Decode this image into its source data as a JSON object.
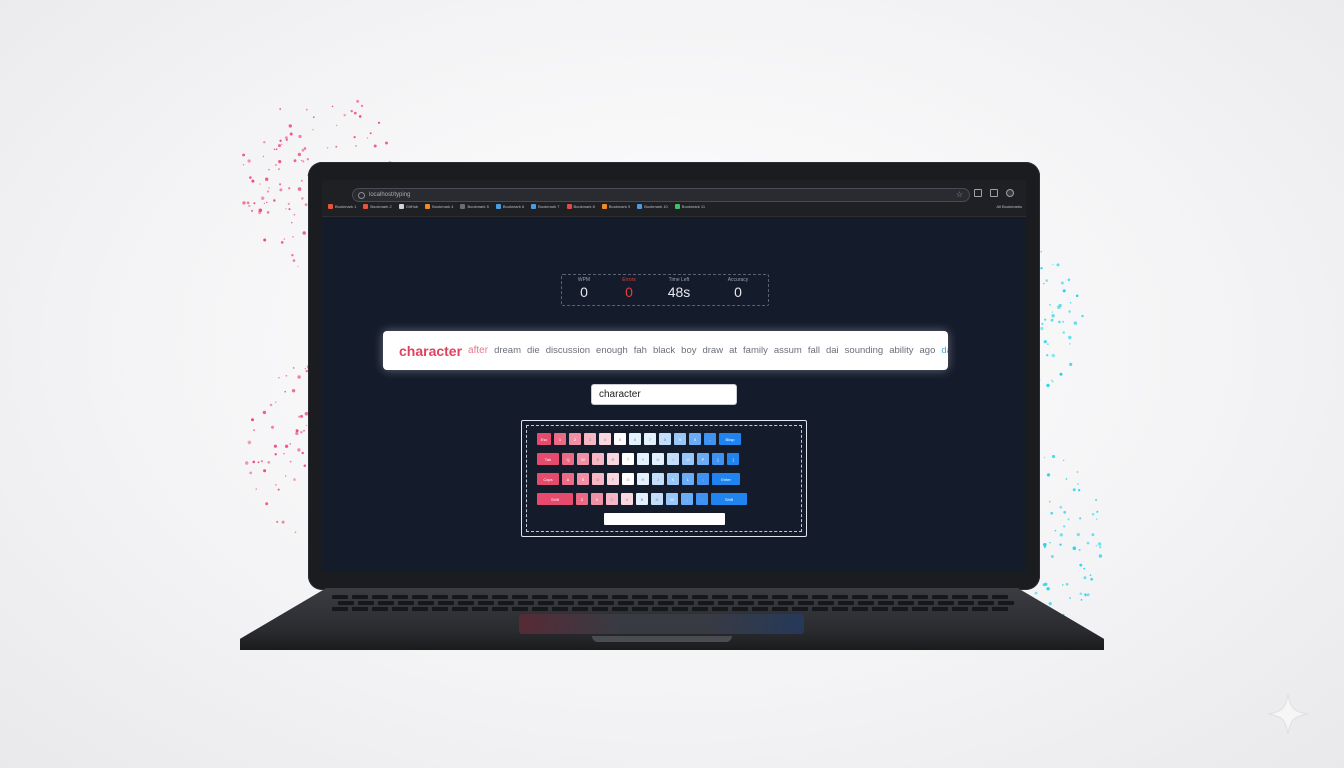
{
  "browser": {
    "address": "localhost/typing",
    "bookmarks": [
      {
        "label": "Bookmark 1",
        "color": "#e8543a"
      },
      {
        "label": "Bookmark 2",
        "color": "#e8543a"
      },
      {
        "label": "GitHub",
        "color": "#d0d3da"
      },
      {
        "label": "Bookmark 4",
        "color": "#f08a24"
      },
      {
        "label": "Bookmark 5",
        "color": "#6a6d75"
      },
      {
        "label": "Bookmark 6",
        "color": "#4a9be0"
      },
      {
        "label": "Bookmark 7",
        "color": "#4a9be0"
      },
      {
        "label": "Bookmark 8",
        "color": "#e24a4a"
      },
      {
        "label": "Bookmark 9",
        "color": "#f08a24"
      },
      {
        "label": "Bookmark 10",
        "color": "#4a9be0"
      },
      {
        "label": "Bookmark 11",
        "color": "#3fbf6a"
      }
    ],
    "all_bookmarks": "All Bookmarks"
  },
  "stats": {
    "wpm": {
      "label": "WPM",
      "value": "0"
    },
    "errors": {
      "label": "Errors",
      "value": "0"
    },
    "time": {
      "label": "Time Left",
      "value": "48s"
    },
    "accuracy": {
      "label": "Accuracy",
      "value": "0"
    }
  },
  "words": [
    "character",
    "after",
    "dream",
    "die",
    "discussion",
    "enough",
    "fah",
    "black",
    "boy",
    "draw",
    "at",
    "family",
    "assum",
    "fall",
    "dai",
    "sounding",
    "ability",
    "ago",
    "day"
  ],
  "input": {
    "value": "character"
  },
  "keyboard": {
    "rows": [
      [
        "Esc",
        "1",
        "2",
        "3",
        "4",
        "5",
        "6",
        "7",
        "8",
        "9",
        "0",
        "-",
        "Bksp"
      ],
      [
        "Tab",
        "Q",
        "W",
        "E",
        "R",
        "T",
        "Y",
        "U",
        "I",
        "O",
        "P",
        "[",
        "]"
      ],
      [
        "Caps",
        "A",
        "S",
        "D",
        "F",
        "G",
        "H",
        "J",
        "K",
        "L",
        ";",
        "Enter"
      ],
      [
        "Shift",
        "Z",
        "X",
        "C",
        "V",
        "B",
        "N",
        "M",
        ",",
        ".",
        "Shift"
      ]
    ]
  },
  "colors": {
    "accent_pink": "#e0415d",
    "accent_blue": "#1f84f0",
    "error_red": "#e53c3c",
    "screen_bg": "#141b2b"
  }
}
